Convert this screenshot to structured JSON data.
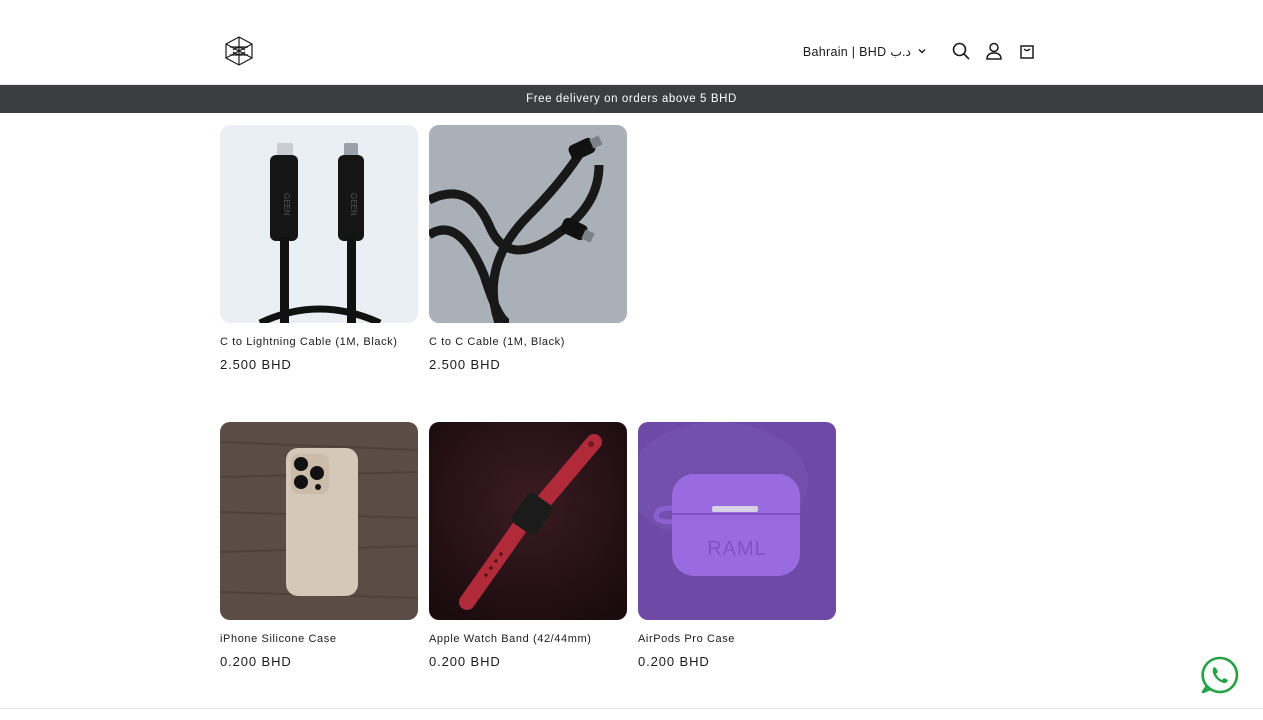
{
  "header": {
    "logo_icon": "brand-logo-icon",
    "country_label": "Bahrain | BHD د.ب",
    "icons": [
      "search-icon",
      "account-icon",
      "cart-icon",
      "chevron-down-icon"
    ]
  },
  "announcement": {
    "text": "Free delivery on orders above 5 BHD"
  },
  "products": [
    {
      "title": "C to Lightning Cable (1M, Black)",
      "price": "2.500 BHD"
    },
    {
      "title": "C to C Cable (1M, Black)",
      "price": "2.500 BHD"
    },
    {
      "title": "iPhone Silicone Case",
      "price": "0.200 BHD"
    },
    {
      "title": "Apple Watch Band (42/44mm)",
      "price": "0.200 BHD"
    },
    {
      "title": "AirPods Pro Case",
      "price": "0.200 BHD",
      "image_text": "RAML"
    }
  ],
  "floating": {
    "whatsapp_icon": "whatsapp-icon"
  },
  "colors": {
    "announcement_bg": "#3b3d40",
    "whatsapp": "#25a244",
    "airpods_purple": "#8e5fd6"
  }
}
